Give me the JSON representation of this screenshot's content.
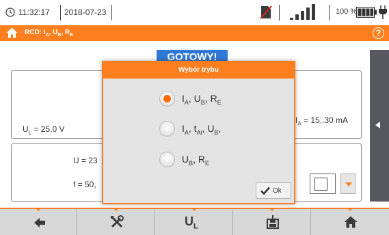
{
  "status_bar": {
    "time": "11:32:17",
    "date": "2018-07-23",
    "battery_percent": "100 %",
    "icons": [
      "clock-icon",
      "sd-card-blocked-icon",
      "signal-bars-icon",
      "battery-icon",
      "charging-plug-icon"
    ]
  },
  "title_bar": {
    "title": "RCD: Iₐ, Uʙ, Rᴇ",
    "title_parts": {
      "main": "RCD: I",
      "a": "A",
      "ub_sep": ", U",
      "b": "B",
      "re_sep": ", R",
      "e": "E"
    },
    "icons": [
      "home-icon",
      "help-icon"
    ],
    "help_label": "?"
  },
  "screen": {
    "ready_badge": "GOTOWY!",
    "ul_prefix": "U",
    "ul_sub": "L",
    "ul_value": " = 25,0 V",
    "ia_prefix": "I",
    "ia_sub": "A",
    "ia_value": " = 15..30 mA",
    "u_value": "U = 23",
    "f_value": "f = 50,"
  },
  "dialog": {
    "title": "Wybór trybu",
    "selected_index": 0,
    "options": [
      {
        "parts": [
          "I",
          "A",
          ", U",
          "B",
          ", R",
          "E"
        ]
      },
      {
        "parts": [
          "I",
          "A",
          ", t",
          "Ai",
          ", U",
          "B",
          ","
        ]
      },
      {
        "parts": [
          "U",
          "B",
          ", R",
          "E"
        ]
      }
    ],
    "ok_label": "Ok",
    "ok_icon": "checkmark-icon"
  },
  "toolbar": {
    "buttons": [
      {
        "name": "back",
        "icon": "arrow-left-icon"
      },
      {
        "name": "settings",
        "icon": "tools-icon"
      },
      {
        "name": "ul-limit",
        "label": "U",
        "sub": "L"
      },
      {
        "name": "save",
        "icon": "save-to-memory-icon"
      },
      {
        "name": "home",
        "icon": "home-icon"
      }
    ]
  },
  "colors": {
    "accent": "#ff7f1e",
    "ready_badge": "#2f78d6",
    "side_tab": "#55595d",
    "toolbar": "#d7d7d7"
  }
}
